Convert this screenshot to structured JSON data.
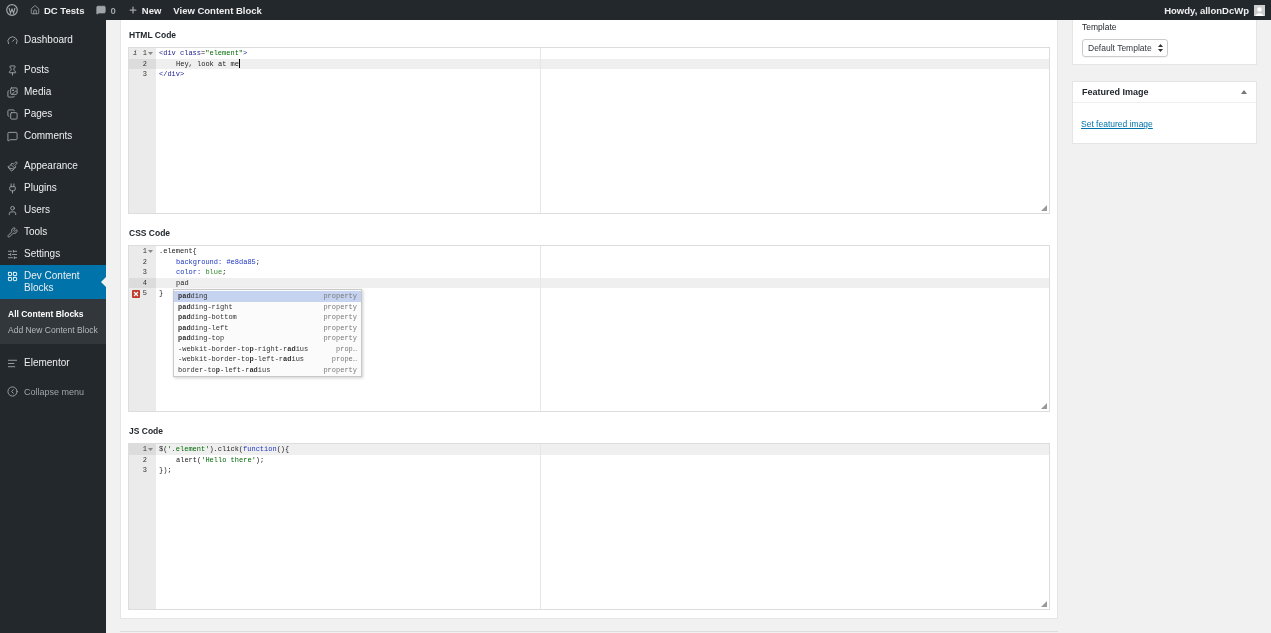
{
  "admin_bar": {
    "site": "DC Tests",
    "comments": "0",
    "new": "New",
    "view": "View Content Block",
    "greeting": "Howdy, allonDcWp"
  },
  "sidebar": {
    "groups": [
      [
        {
          "label": "Dashboard",
          "selected": false
        }
      ],
      [
        {
          "label": "Posts",
          "selected": false
        },
        {
          "label": "Media",
          "selected": false
        },
        {
          "label": "Pages",
          "selected": false
        },
        {
          "label": "Comments",
          "selected": false
        }
      ],
      [
        {
          "label": "Appearance",
          "selected": false
        },
        {
          "label": "Plugins",
          "selected": false
        },
        {
          "label": "Users",
          "selected": false
        },
        {
          "label": "Tools",
          "selected": false
        },
        {
          "label": "Settings",
          "selected": false
        },
        {
          "label": "Dev Content Blocks",
          "selected": true,
          "submenu": [
            {
              "label": "All Content Blocks",
              "selected": true
            },
            {
              "label": "Add New Content Block",
              "selected": false
            }
          ]
        }
      ],
      [
        {
          "label": "Elementor",
          "selected": false
        }
      ]
    ],
    "collapse": "Collapse menu"
  },
  "editors": [
    {
      "title": "HTML Code",
      "lines": [
        {
          "number": "1",
          "marker": {
            "kind": "info",
            "text": "i"
          },
          "foldable": true,
          "active": false,
          "indented": false,
          "tokens": [
            {
              "text": "<div",
              "kind": "tag"
            },
            {
              "text": " class",
              "kind": "attr"
            },
            {
              "text": "=",
              "kind": "plain"
            },
            {
              "text": "\"element\"",
              "kind": "string"
            },
            {
              "text": ">",
              "kind": "tag"
            }
          ]
        },
        {
          "number": "2",
          "foldable": false,
          "active": true,
          "indented": true,
          "cursor": true,
          "tokens": [
            {
              "text": "Hey, look at me",
              "kind": "plain"
            }
          ]
        },
        {
          "number": "3",
          "foldable": false,
          "active": false,
          "indented": false,
          "tokens": [
            {
              "text": "</div>",
              "kind": "tag"
            }
          ]
        }
      ]
    },
    {
      "title": "CSS Code",
      "lines": [
        {
          "number": "1",
          "foldable": true,
          "active": false,
          "indented": false,
          "tokens": [
            {
              "text": ".element",
              "kind": "plain"
            },
            {
              "text": "{",
              "kind": "plain"
            }
          ]
        },
        {
          "number": "2",
          "foldable": false,
          "active": false,
          "indented": true,
          "tokens": [
            {
              "text": "background:",
              "kind": "property"
            },
            {
              "text": " #e8da85",
              "kind": "value"
            },
            {
              "text": ";",
              "kind": "plain"
            }
          ]
        },
        {
          "number": "3",
          "foldable": false,
          "active": false,
          "indented": true,
          "tokens": [
            {
              "text": "color:",
              "kind": "property"
            },
            {
              "text": " blue",
              "kind": "constant"
            },
            {
              "text": ";",
              "kind": "plain"
            }
          ]
        },
        {
          "number": "4",
          "foldable": false,
          "active": true,
          "indented": true,
          "tokens": [
            {
              "text": "pad",
              "kind": "plain"
            }
          ]
        },
        {
          "number": "5",
          "marker": {
            "kind": "error"
          },
          "foldable": false,
          "active": false,
          "indented": false,
          "tokens": [
            {
              "text": "}",
              "kind": "plain"
            }
          ]
        }
      ],
      "autocomplete": [
        {
          "label": "**pad**ding",
          "meta": "property",
          "selected": true
        },
        {
          "label": "**pad**ding-right",
          "meta": "property",
          "selected": false
        },
        {
          "label": "**pad**ding-bottom",
          "meta": "property",
          "selected": false
        },
        {
          "label": "**pad**ding-left",
          "meta": "property",
          "selected": false
        },
        {
          "label": "**pad**ding-top",
          "meta": "property",
          "selected": false
        },
        {
          "label": "-webkit-border-to**p**-right-r**ad**ius",
          "meta": "prop…",
          "selected": false
        },
        {
          "label": "-webkit-border-to**p**-left-r**ad**ius",
          "meta": "prope…",
          "selected": false
        },
        {
          "label": "border-to**p**-left-r**ad**ius",
          "meta": "property",
          "selected": false
        }
      ]
    },
    {
      "title": "JS Code",
      "lines": [
        {
          "number": "1",
          "foldable": true,
          "active": true,
          "indented": false,
          "tokens": [
            {
              "text": "$(",
              "kind": "plain"
            },
            {
              "text": "'.element'",
              "kind": "string"
            },
            {
              "text": ").click(",
              "kind": "plain"
            },
            {
              "text": "function",
              "kind": "keyword"
            },
            {
              "text": "(){",
              "kind": "plain"
            }
          ]
        },
        {
          "number": "2",
          "foldable": false,
          "active": false,
          "indented": true,
          "tokens": [
            {
              "text": "alert(",
              "kind": "plain"
            },
            {
              "text": "'Hello there'",
              "kind": "string"
            },
            {
              "text": ");",
              "kind": "plain"
            }
          ]
        },
        {
          "number": "3",
          "foldable": false,
          "active": false,
          "indented": false,
          "tokens": [
            {
              "text": "});",
              "kind": "plain"
            }
          ]
        }
      ]
    }
  ],
  "template": {
    "label": "Template",
    "value": "Default Template"
  },
  "featured_image": {
    "title": "Featured Image",
    "expanded": true,
    "link": "Set featured image"
  }
}
